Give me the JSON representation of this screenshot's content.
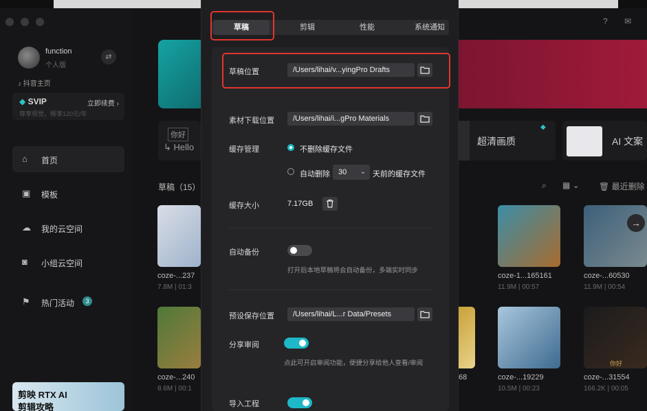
{
  "settings": {
    "tabs": [
      {
        "label": "草稿"
      },
      {
        "label": "剪辑"
      },
      {
        "label": "性能"
      },
      {
        "label": "系统通知"
      }
    ],
    "draft_location": {
      "label": "草稿位置",
      "path": "/Users/lihai/v...yingPro Drafts"
    },
    "material_download": {
      "label": "素材下载位置",
      "path": "/Users/lihai/i...gPro Materials"
    },
    "cache_manage": {
      "label": "缓存管理",
      "option_keep": "不删除缓存文件",
      "option_auto_prefix": "自动删除",
      "days": "30",
      "option_auto_suffix": "天前的缓存文件",
      "selected": "option_keep"
    },
    "cache_size": {
      "label": "缓存大小",
      "value": "7.17GB"
    },
    "auto_backup": {
      "label": "自动备份",
      "enabled": false,
      "hint": "打开后本地草稿将会自动备份，多端实时同步"
    },
    "preset_location": {
      "label": "预设保存位置",
      "path": "/Users/lihai/L...r Data/Presets"
    },
    "share_review": {
      "label": "分享审阅",
      "enabled": true,
      "hint": "点此可开启审阅功能，便捷分享给他人查看/审阅"
    },
    "import_project": {
      "label": "导入工程",
      "enabled": true
    }
  },
  "sidebar": {
    "user_name": "function",
    "user_sub": "个人版",
    "douyin": "抖音主页",
    "svip_title": "SVIP",
    "svip_renew": "立即续费",
    "svip_sub": "尊享视觉，畅享120元/年",
    "nav": [
      {
        "label": "首页"
      },
      {
        "label": "模板"
      },
      {
        "label": "我的云空间"
      },
      {
        "label": "小组云空间"
      },
      {
        "label": "热门活动",
        "badge": "3"
      }
    ],
    "promo_line1": "剪映 RTX AI",
    "promo_line2": "剪辑攻略"
  },
  "main": {
    "feature_hd": "超清画质",
    "feature_ai": "AI 文案",
    "hello_tag": "你好",
    "hello_text": "Hello",
    "drafts_header": "草稿（15）",
    "recent_delete": "最近删除",
    "drafts": [
      {
        "name": "coze-...237",
        "meta": "7.8M | 01:3"
      },
      {
        "name": "coze-1...165161",
        "meta": "11.9M | 00:57"
      },
      {
        "name": "coze-...60530",
        "meta": "11.9M | 00:54"
      },
      {
        "name": "coze-...240",
        "meta": "8.6M | 00:1"
      },
      {
        "name": "68",
        "meta": ""
      },
      {
        "name": "coze-...19229",
        "meta": "10.5M | 00:23"
      },
      {
        "name": "coze-...31554",
        "meta": "166.2K | 00:05"
      }
    ],
    "thumb_tag": "你好"
  }
}
